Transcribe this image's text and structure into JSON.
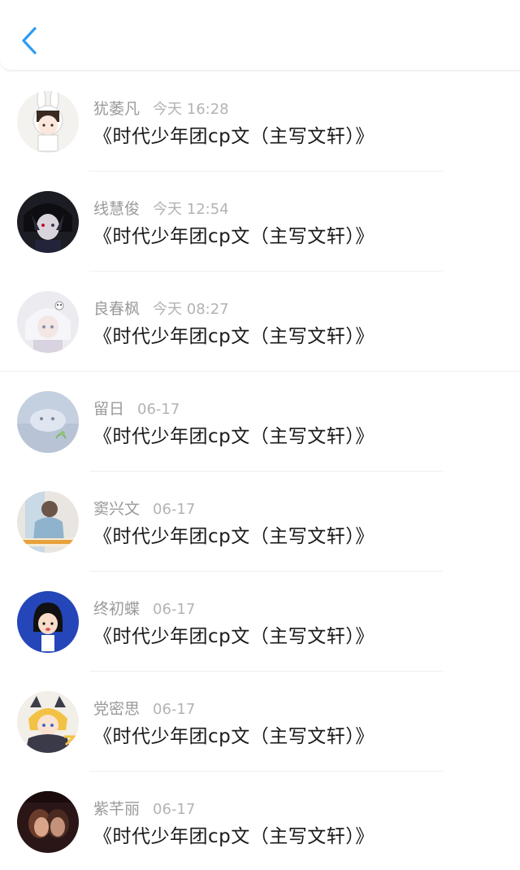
{
  "header": {
    "back_icon": "chevron-left-icon",
    "accent_color": "#2d9cf2"
  },
  "items": [
    {
      "name": "犹萎凡",
      "time": "今天 16:28",
      "title": "《时代少年团cp文（主写文轩）》"
    },
    {
      "name": "线慧俊",
      "time": "今天 12:54",
      "title": "《时代少年团cp文（主写文轩）》"
    },
    {
      "name": "良春枫",
      "time": "今天 08:27",
      "title": "《时代少年团cp文（主写文轩）》"
    },
    {
      "name": "留日",
      "time": "06-17",
      "title": "《时代少年团cp文（主写文轩）》"
    },
    {
      "name": "窦兴文",
      "time": "06-17",
      "title": "《时代少年团cp文（主写文轩）》"
    },
    {
      "name": "终初蝶",
      "time": "06-17",
      "title": "《时代少年团cp文（主写文轩）》"
    },
    {
      "name": "党密思",
      "time": "06-17",
      "title": "《时代少年团cp文（主写文轩）》"
    },
    {
      "name": "紫芊丽",
      "time": "06-17",
      "title": "《时代少年团cp文（主写文轩）》"
    }
  ]
}
